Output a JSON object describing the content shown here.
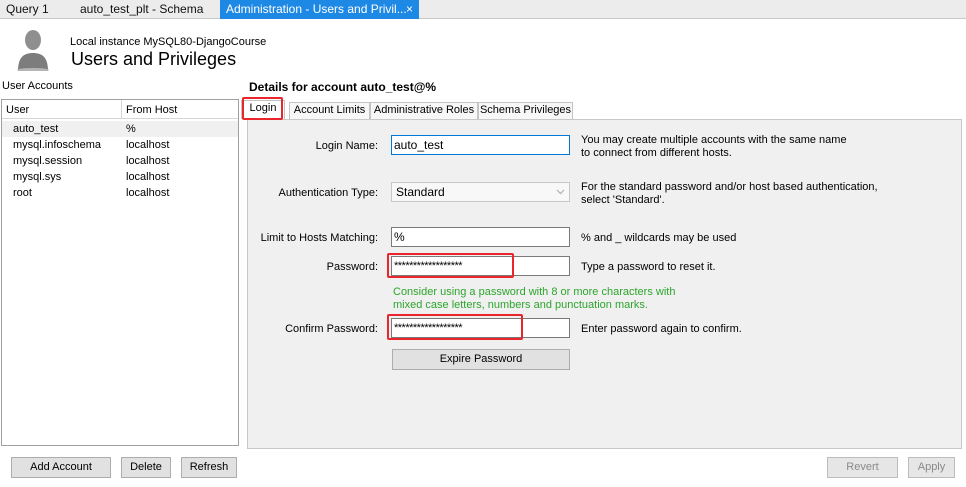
{
  "doc_tabs": [
    {
      "label": "Query 1"
    },
    {
      "label": "auto_test_plt - Schema"
    },
    {
      "label": "Administration - Users and Privil...",
      "close": "×"
    }
  ],
  "header": {
    "instance": "Local instance MySQL80-DjangoCourse",
    "title": "Users and Privileges"
  },
  "accounts": {
    "label": "User Accounts",
    "col_user": "User",
    "col_host": "From Host",
    "rows": [
      {
        "user": "auto_test",
        "host": "%"
      },
      {
        "user": "mysql.infoschema",
        "host": "localhost"
      },
      {
        "user": "mysql.session",
        "host": "localhost"
      },
      {
        "user": "mysql.sys",
        "host": "localhost"
      },
      {
        "user": "root",
        "host": "localhost"
      }
    ],
    "add_label": "Add Account",
    "delete_label": "Delete",
    "refresh_label": "Refresh"
  },
  "details": {
    "title": "Details for account auto_test@%",
    "tabs": [
      "Login",
      "Account Limits",
      "Administrative Roles",
      "Schema Privileges"
    ],
    "login_name_label": "Login Name:",
    "login_name_value": "auto_test",
    "login_name_hint1": "You may create multiple accounts with the same name",
    "login_name_hint2": "to connect from different hosts.",
    "auth_label": "Authentication Type:",
    "auth_value": "Standard",
    "auth_hint1": "For the standard password and/or host based authentication,",
    "auth_hint2": "select 'Standard'.",
    "hosts_label": "Limit to Hosts Matching:",
    "hosts_value": "%",
    "hosts_hint": "% and _ wildcards may be used",
    "password_label": "Password:",
    "password_value": "******************",
    "password_hint": "Type a password to reset it.",
    "password_advice1": "Consider using a password with 8 or more characters with",
    "password_advice2": "mixed case letters, numbers and punctuation marks.",
    "confirm_label": "Confirm Password:",
    "confirm_value": "******************",
    "confirm_hint": "Enter password again to confirm.",
    "expire_label": "Expire Password"
  },
  "footer": {
    "revert_label": "Revert",
    "apply_label": "Apply"
  },
  "colors": {
    "accent": "#1e88e5",
    "highlight": "#e8262b",
    "advice": "#2da52d"
  }
}
